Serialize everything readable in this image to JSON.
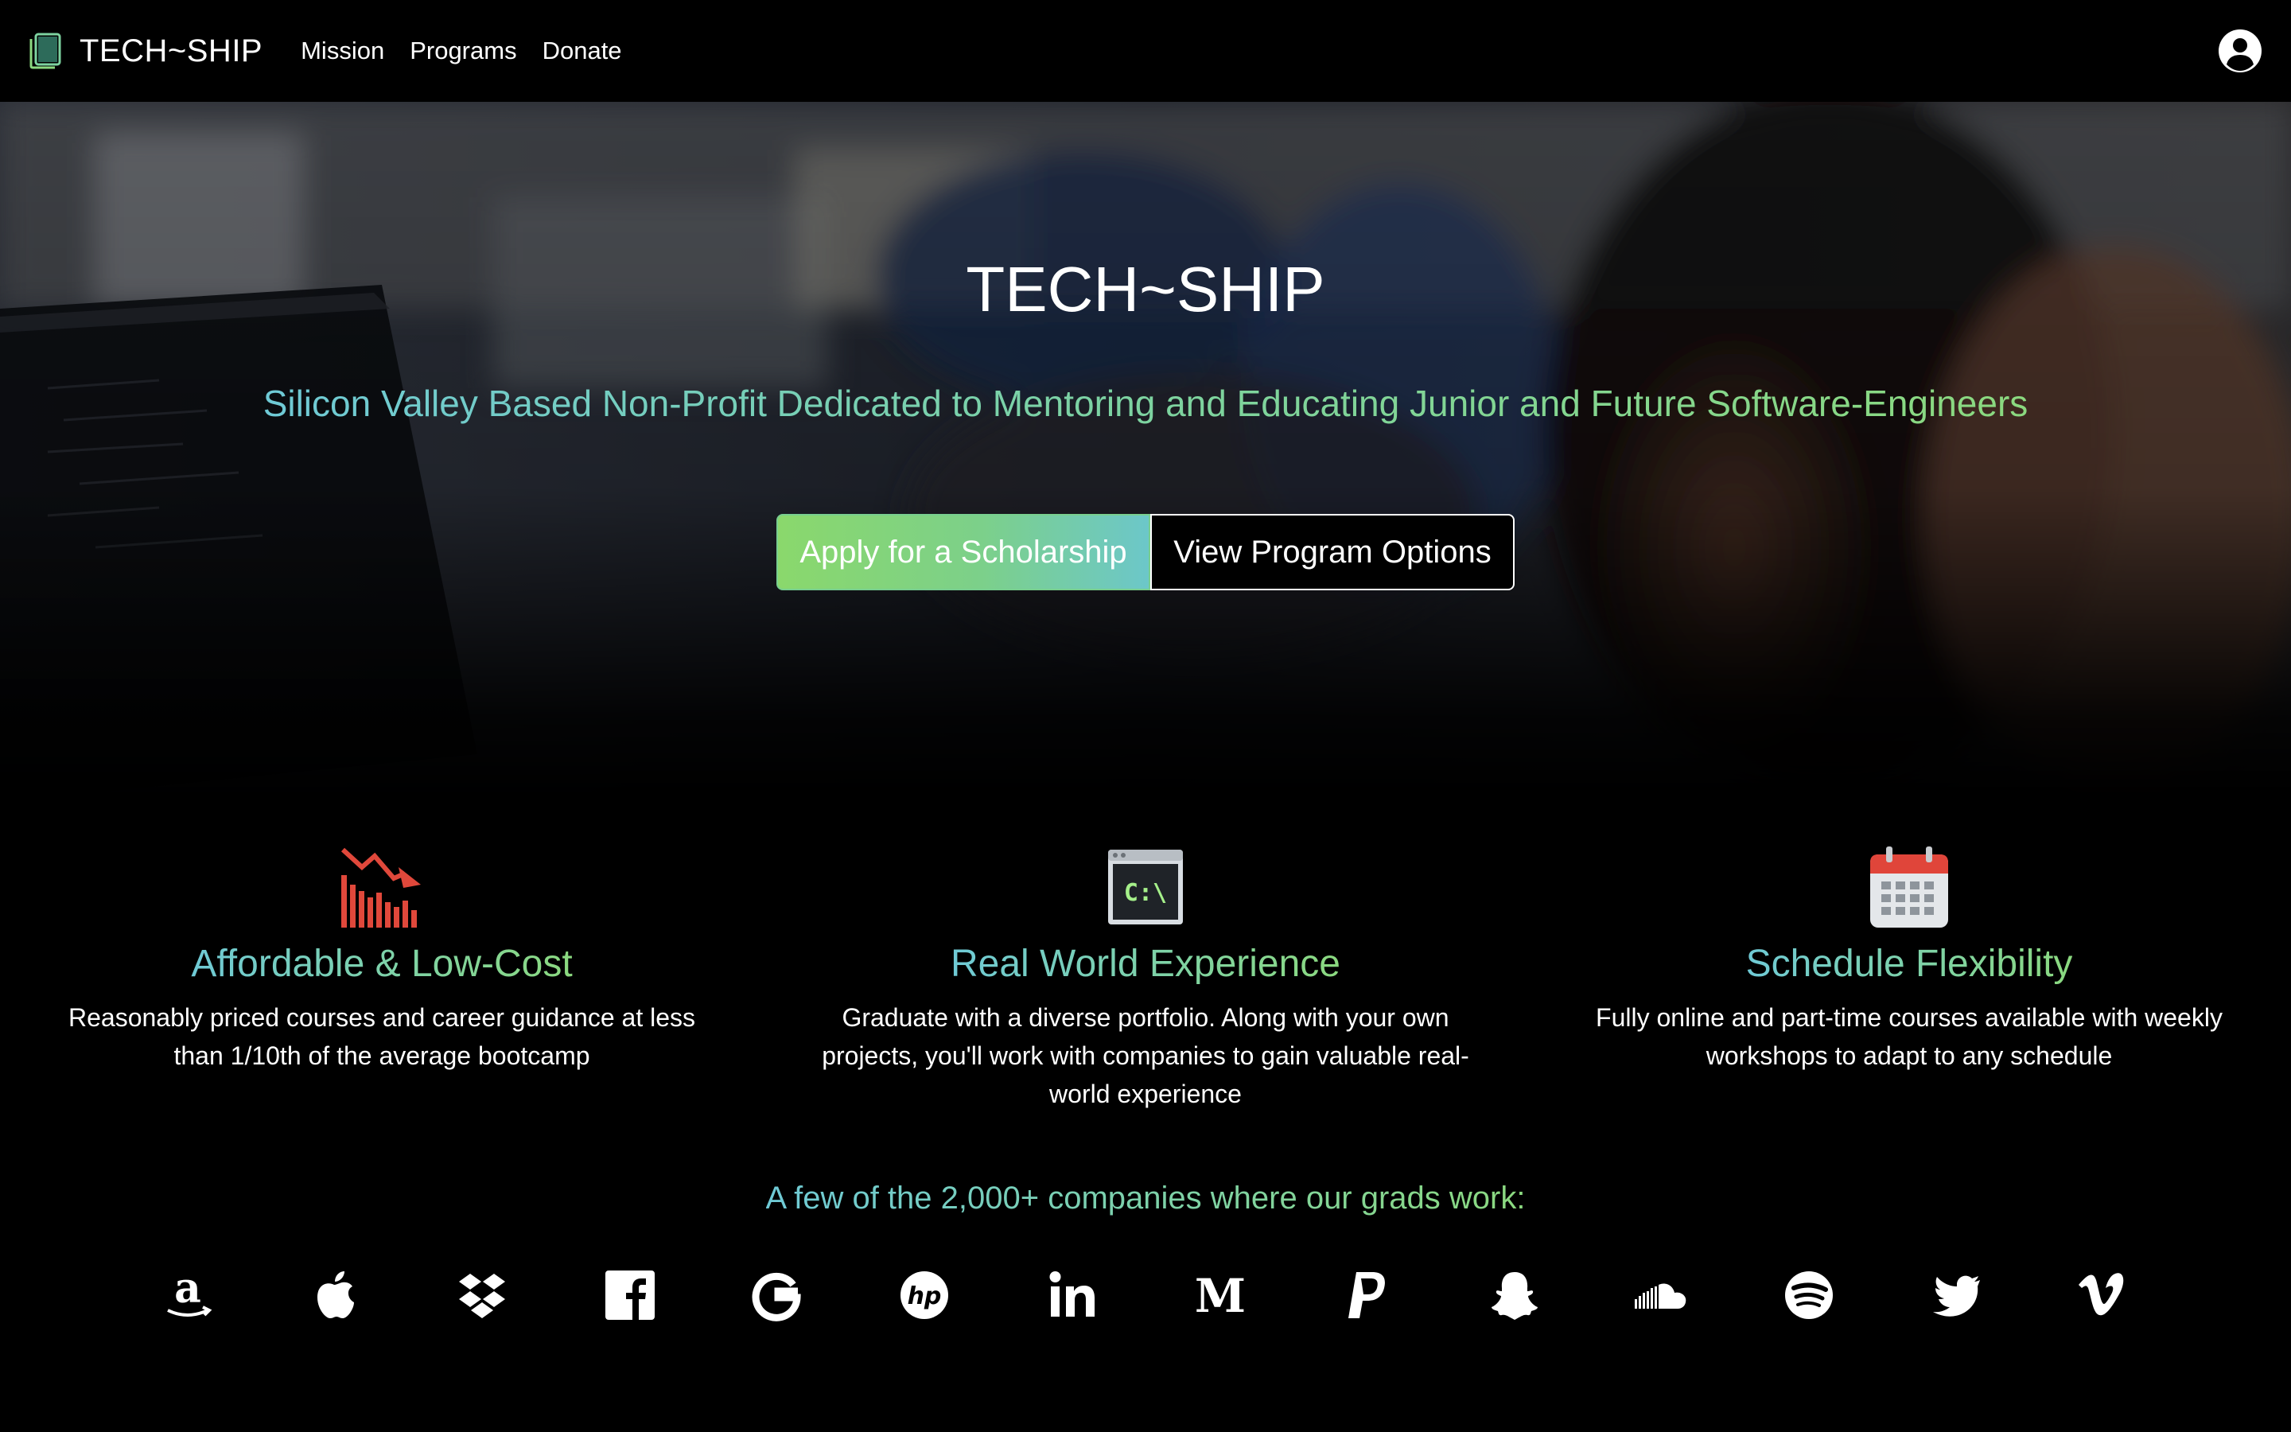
{
  "navbar": {
    "brand": "TECH~SHIP",
    "links": [
      "Mission",
      "Programs",
      "Donate"
    ]
  },
  "hero": {
    "title": "TECH~SHIP",
    "tagline": "Silicon Valley Based Non-Profit Dedicated to Mentoring and Educating Junior and Future Software-Engineers",
    "apply_button": "Apply for a Scholarship",
    "view_button": "View Program Options"
  },
  "features": [
    {
      "icon": "chart-decreasing-icon",
      "title": "Affordable & Low-Cost",
      "description": "Reasonably priced courses and career guidance at less than 1/10th of the average bootcamp"
    },
    {
      "icon": "terminal-icon",
      "icon_text": "C:\\",
      "title": "Real World Experience",
      "description": "Graduate with a diverse portfolio. Along with your own projects, you'll work with companies to gain valuable real-world experience"
    },
    {
      "icon": "calendar-icon",
      "title": "Schedule Flexibility",
      "description": "Fully online and part-time courses available with weekly workshops to adapt to any schedule"
    }
  ],
  "companies": {
    "title": "A few of the 2,000+ companies where our grads work:",
    "logos": [
      "amazon-logo",
      "apple-logo",
      "dropbox-logo",
      "facebook-logo",
      "google-logo",
      "hp-logo",
      "linkedin-logo",
      "medium-logo",
      "paypal-logo",
      "snapchat-logo",
      "soundcloud-logo",
      "spotify-logo",
      "twitter-logo",
      "vimeo-logo"
    ]
  },
  "colors": {
    "accent_teal": "#6fcad6",
    "accent_green": "#8bd97f",
    "background": "#000000"
  }
}
